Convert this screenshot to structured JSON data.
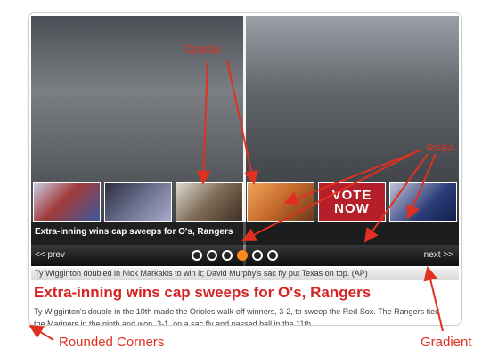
{
  "slideshow": {
    "caption": "Extra-inning wins cap sweeps for O's, Rangers",
    "prev_label": "<< prev",
    "next_label": "next >>",
    "summary": "Ty Wigginton doubled in Nick Markakis to win it; David Murphy's sac fly put Texas on top. (AP)",
    "headline": "Extra-inning wins cap sweeps for O's, Rangers",
    "body": "Ty Wigginton's double in the 10th made the Orioles walk-off winners, 3-2, to sweep the Red Sox. The Rangers tied the Mariners in the ninth and won, 3-1, on a sac fly and passed ball in the 11th.",
    "thumbnails": [
      {
        "name": "thumb-1"
      },
      {
        "name": "thumb-2"
      },
      {
        "name": "thumb-3"
      },
      {
        "name": "thumb-4"
      },
      {
        "name": "thumb-5",
        "text": "VOTE NOW"
      },
      {
        "name": "thumb-6"
      }
    ],
    "pager": {
      "count": 6,
      "active_index": 4
    },
    "colors": {
      "accent": "#d62424",
      "active_dot": "#ff8a1c"
    }
  },
  "annotations": {
    "opacity": "Opacity",
    "rgba": "RGBA",
    "rounded_corners": "Rounded Corners",
    "gradient": "Gradient",
    "color": "#e03020"
  }
}
